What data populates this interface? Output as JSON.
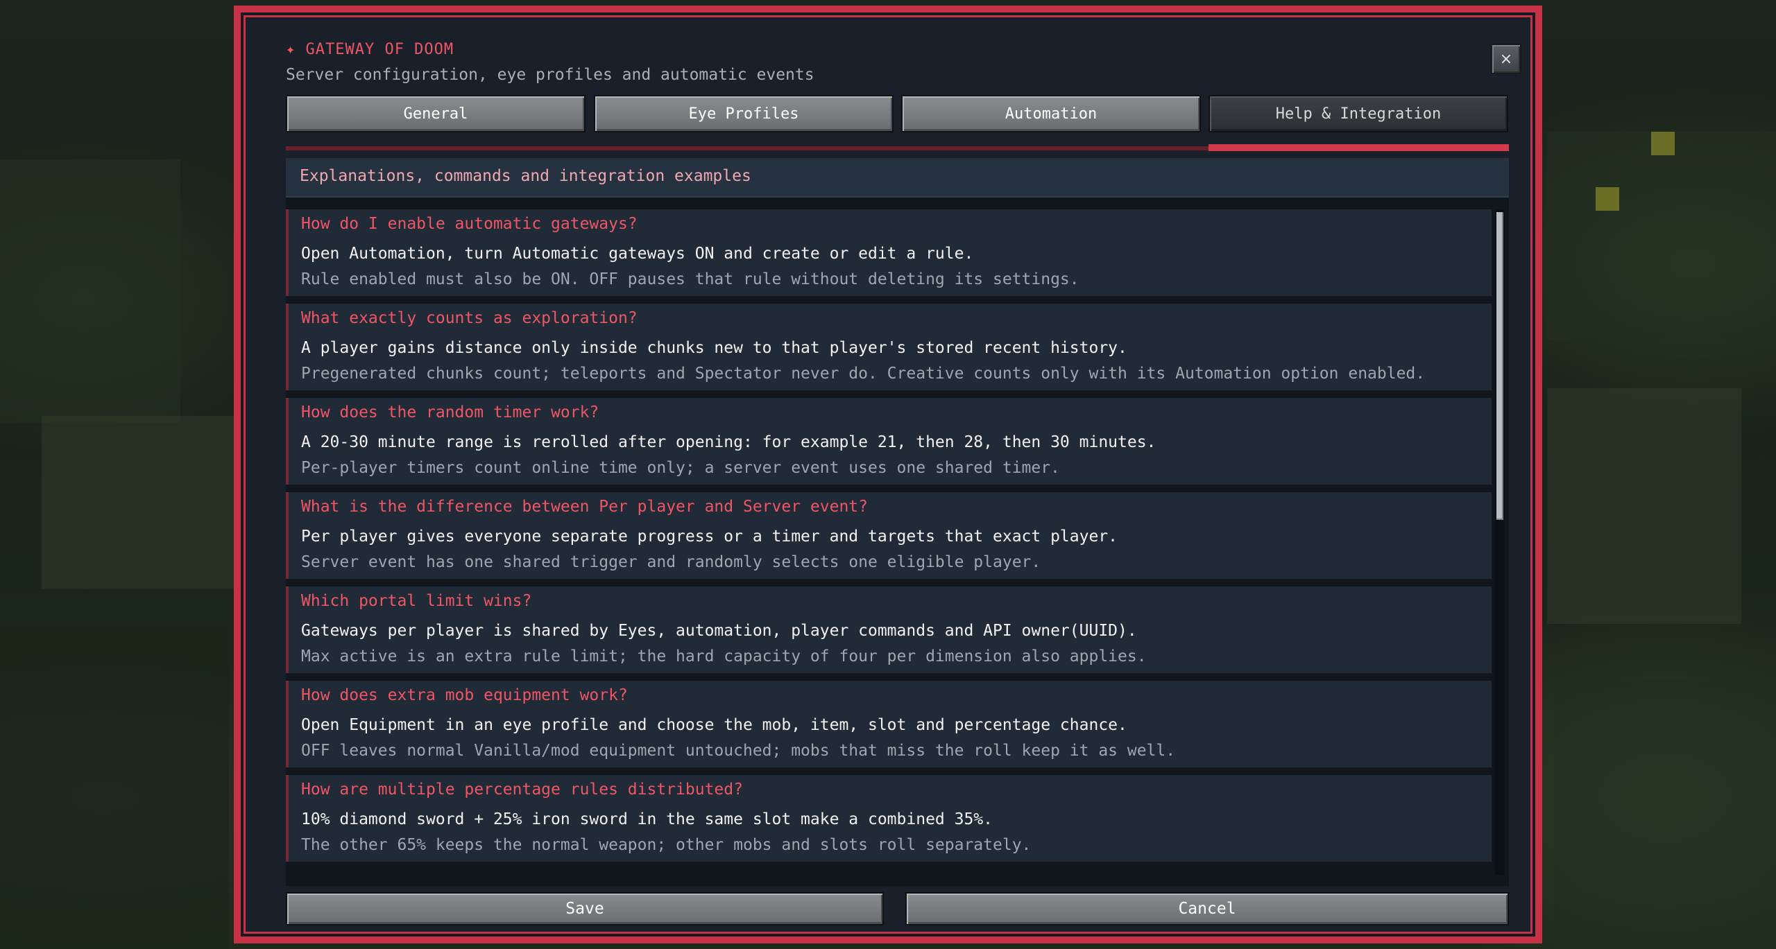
{
  "window": {
    "title": "✦ GATEWAY OF DOOM",
    "subtitle": "Server configuration, eye profiles and automatic events",
    "close_label": "×"
  },
  "tabs": [
    {
      "label": "General",
      "active": false
    },
    {
      "label": "Eye Profiles",
      "active": false
    },
    {
      "label": "Automation",
      "active": false
    },
    {
      "label": "Help & Integration",
      "active": true
    }
  ],
  "content": {
    "header": "Explanations, commands and integration examples",
    "items": [
      {
        "question": "How do I enable automatic gateways?",
        "answer": "Open Automation, turn Automatic gateways ON and create or edit a rule.",
        "note": "Rule enabled must also be ON. OFF pauses that rule without deleting its settings."
      },
      {
        "question": "What exactly counts as exploration?",
        "answer": "A player gains distance only inside chunks new to that player's stored recent history.",
        "note": "Pregenerated chunks count; teleports and Spectator never do. Creative counts only with its Automation option enabled."
      },
      {
        "question": "How does the random timer work?",
        "answer": "A 20-30 minute range is rerolled after opening: for example 21, then 28, then 30 minutes.",
        "note": "Per-player timers count online time only; a server event uses one shared timer."
      },
      {
        "question": "What is the difference between Per player and Server event?",
        "answer": "Per player gives everyone separate progress or a timer and targets that exact player.",
        "note": "Server event has one shared trigger and randomly selects one eligible player."
      },
      {
        "question": "Which portal limit wins?",
        "answer": "Gateways per player is shared by Eyes, automation, player commands and API owner(UUID).",
        "note": "Max active is an extra rule limit; the hard capacity of four per dimension also applies."
      },
      {
        "question": "How does extra mob equipment work?",
        "answer": "Open Equipment in an eye profile and choose the mob, item, slot and percentage chance.",
        "note": "OFF leaves normal Vanilla/mod equipment untouched; mobs that miss the roll keep it as well."
      },
      {
        "question": "How are multiple percentage rules distributed?",
        "answer": "10% diamond sword + 25% iron sword in the same slot make a combined 35%.",
        "note": "The other 65% keeps the normal weapon; other mobs and slots roll separately."
      }
    ]
  },
  "footer": {
    "save_label": "Save",
    "cancel_label": "Cancel"
  },
  "colors": {
    "accent": "#c83247",
    "question": "#ee5665",
    "panel": "#212b38"
  }
}
